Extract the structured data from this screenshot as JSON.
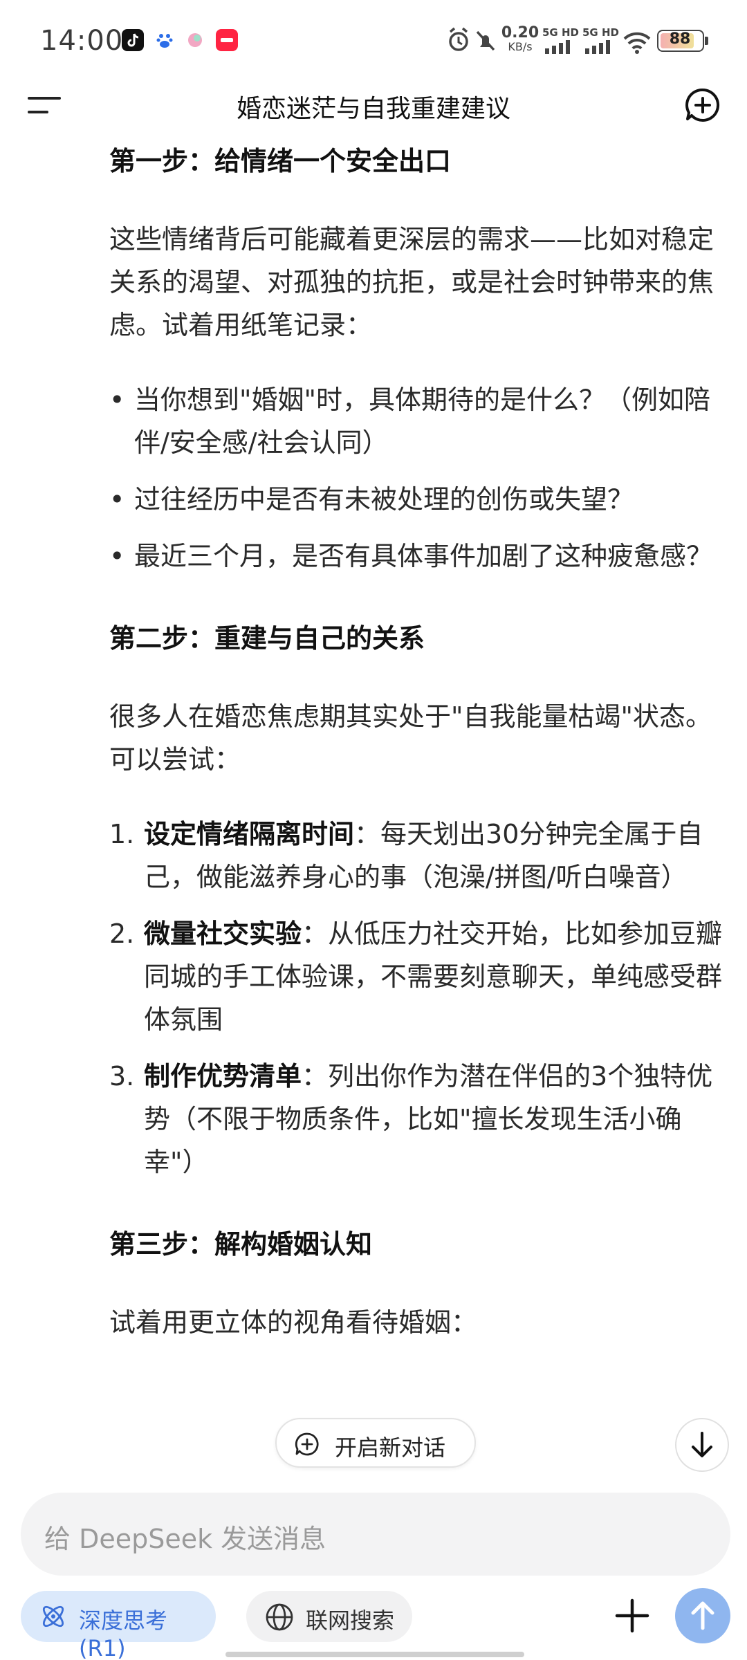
{
  "status_bar": {
    "time": "14:00",
    "net_speed_value": "0.20",
    "net_speed_unit": "KB/s",
    "signal1_label": "5G HD",
    "signal2_label": "5G HD",
    "battery": "88"
  },
  "header": {
    "title": "婚恋迷茫与自我重建建议"
  },
  "content": {
    "step1": {
      "title": "第一步：给情绪一个安全出口",
      "intro": "这些情绪背后可能藏着更深层的需求——比如对稳定关系的渴望、对孤独的抗拒，或是社会时钟带来的焦虑。试着用纸笔记录：",
      "bullets": [
        "当你想到\"婚姻\"时，具体期待的是什么？（例如陪伴/安全感/社会认同）",
        "过往经历中是否有未被处理的创伤或失望？",
        "最近三个月，是否有具体事件加剧了这种疲惫感？"
      ]
    },
    "step2": {
      "title": "第二步：重建与自己的关系",
      "intro": "很多人在婚恋焦虑期其实处于\"自我能量枯竭\"状态。可以尝试：",
      "items": [
        {
          "num": "1.",
          "bold": "设定情绪隔离时间",
          "text": "：每天划出30分钟完全属于自己，做能滋养身心的事（泡澡/拼图/听白噪音）"
        },
        {
          "num": "2.",
          "bold": "微量社交实验",
          "text": "：从低压力社交开始，比如参加豆瓣同城的手工体验课，不需要刻意聊天，单纯感受群体氛围"
        },
        {
          "num": "3.",
          "bold": "制作优势清单",
          "text": "：列出你作为潜在伴侣的3个独特优势（不限于物质条件，比如\"擅长发现生活小确幸\"）"
        }
      ]
    },
    "step3": {
      "title": "第三步：解构婚姻认知",
      "intro": "试着用更立体的视角看待婚姻："
    }
  },
  "floating": {
    "new_chat_label": "开启新对话"
  },
  "composer": {
    "placeholder": "给 DeepSeek 发送消息",
    "deep_think_label": "深度思考 (R1)",
    "web_search_label": "联网搜索"
  },
  "colors": {
    "accent": "#3a6fd8",
    "accent_bg": "#dbe9fb",
    "send_button": "#8fb6ef"
  }
}
